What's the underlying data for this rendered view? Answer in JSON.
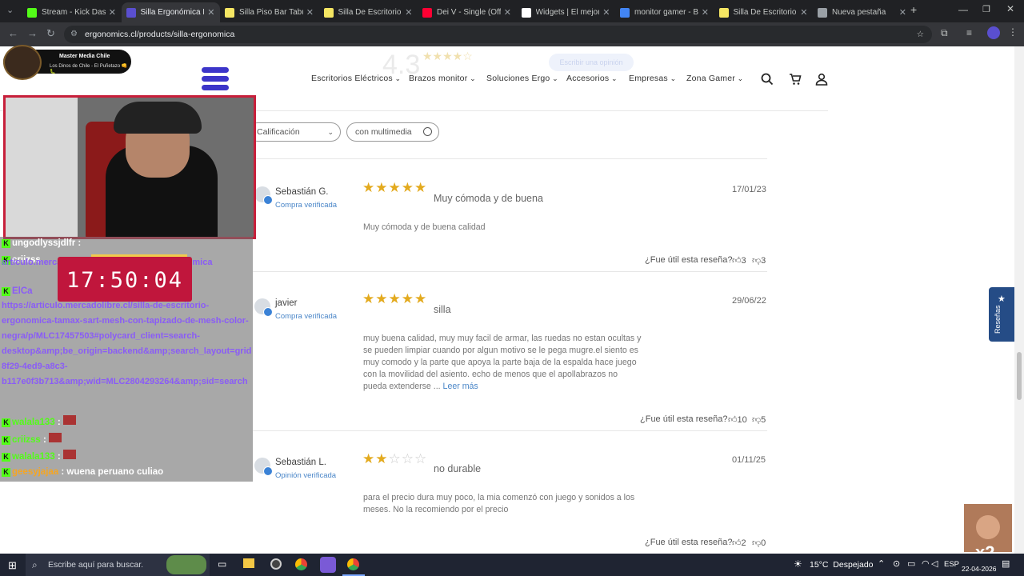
{
  "browser": {
    "tabs": [
      {
        "title": "Stream - Kick Dashbo",
        "favicon_color": "#53fc18"
      },
      {
        "title": "Silla Ergonómica Mir",
        "favicon_color": "#5a4fcf",
        "active": true
      },
      {
        "title": "Silla Piso Bar Taburet",
        "favicon_color": "#f5e663"
      },
      {
        "title": "Silla De Escritorio Co",
        "favicon_color": "#f5e663"
      },
      {
        "title": "Dei V - Single (Officia",
        "favicon_color": "#ff0033"
      },
      {
        "title": "Widgets | El mejor so",
        "favicon_color": "#ffffff"
      },
      {
        "title": "monitor gamer - Bus",
        "favicon_color": "#4285f4"
      },
      {
        "title": "Silla De Escritorio Co",
        "favicon_color": "#f5e663"
      },
      {
        "title": "Nueva pestaña",
        "favicon_color": "#9aa0a6"
      }
    ],
    "url": "ergonomics.cl/products/silla-ergonomica"
  },
  "site": {
    "rating": "4.3",
    "write_review": "Escribir una opinión",
    "menu": [
      "Escritorios Eléctricos",
      "Brazos monitor",
      "Soluciones Ergo",
      "Accesorios",
      "Empresas",
      "Zona Gamer"
    ],
    "filter_select": "Calificación",
    "filter_media": "con multimedia",
    "side_tab": "Reseñas"
  },
  "reviews": [
    {
      "name": "Sebastián G.",
      "status": "Compra verificada",
      "stars": 5,
      "title": "Muy cómoda y de buena",
      "date": "17/01/23",
      "body": "Muy cómoda y de buena calidad",
      "more": "",
      "helpful_q": "¿Fue útil esta reseña?",
      "up": "3",
      "down": "3"
    },
    {
      "name": "javier",
      "status": "Compra verificada",
      "stars": 5,
      "title": "silla",
      "date": "29/06/22",
      "body": "muy buena calidad, muy muy facil de armar, las ruedas no estan ocultas y se pueden limpiar cuando por algun motivo se le pega mugre.el siento es muy comodo y la parte que apoya la parte baja de la espalda hace juego con la movilidad del asiento. echo de menos que el apollabrazos no pueda extenderse ...",
      "more": "Leer más",
      "helpful_q": "¿Fue útil esta reseña?",
      "up": "10",
      "down": "5"
    },
    {
      "name": "Sebastián L.",
      "status": "Opinión verificada",
      "stars": 2,
      "title": "no durable",
      "date": "01/11/25",
      "body": "para el precio dura muy poco, la mia comenzó con juego y sonidos a los meses. No la recomiendo por el precio",
      "more": "",
      "helpful_q": "¿Fue útil esta reseña?",
      "up": "2",
      "down": "0"
    }
  ],
  "stream": {
    "badge_title": "Master Media Chile",
    "badge_sub": "Los Dinos de Chile - El Puñetazo 👊🐛",
    "clock": "17:50:04",
    "chat": [
      {
        "user": "ungodlyssjdlfr",
        "msg": "",
        "color": "#ffffff"
      },
      {
        "user": "criizss",
        "msg": "",
        "color": "#ffffff"
      },
      {
        "user": "ElCa",
        "msg": "",
        "color": "#8a5cf6"
      },
      {
        "user": "walala133",
        "msg": "",
        "color": "#53fc18"
      },
      {
        "user": "criizss",
        "msg": "",
        "color": "#53fc18"
      },
      {
        "user": "walala133",
        "msg": "",
        "color": "#53fc18"
      },
      {
        "user": "geesyjajaa",
        "msg": "wuena peruano culiao",
        "color": "#f5a623"
      }
    ],
    "link1": "articulo.mercadolibre.cl/p/MLC... /silla-ergonomica",
    "link2": "https://articulo.mercadolibre.cl/silla-de-escritorio-ergonomica-tamax-sart-mesh-con-tapizado-de-mesh-color-negra/p/MLC17457503#polycard_client=search-desktop&amp;be_origin=backend&amp;search_layout=grid&amp;position=11&amp;type=product&amp;tracking_id=96616f92-8f29-4ed9-a8c3-b117e0f3b713&amp;wid=MLC2804293264&amp;sid=search",
    "meme_text": "x2"
  },
  "taskbar": {
    "search": "Escribe aquí para buscar.",
    "weather": "15°C  Despejado",
    "lang": "ESP",
    "date": "22-04-2026"
  }
}
